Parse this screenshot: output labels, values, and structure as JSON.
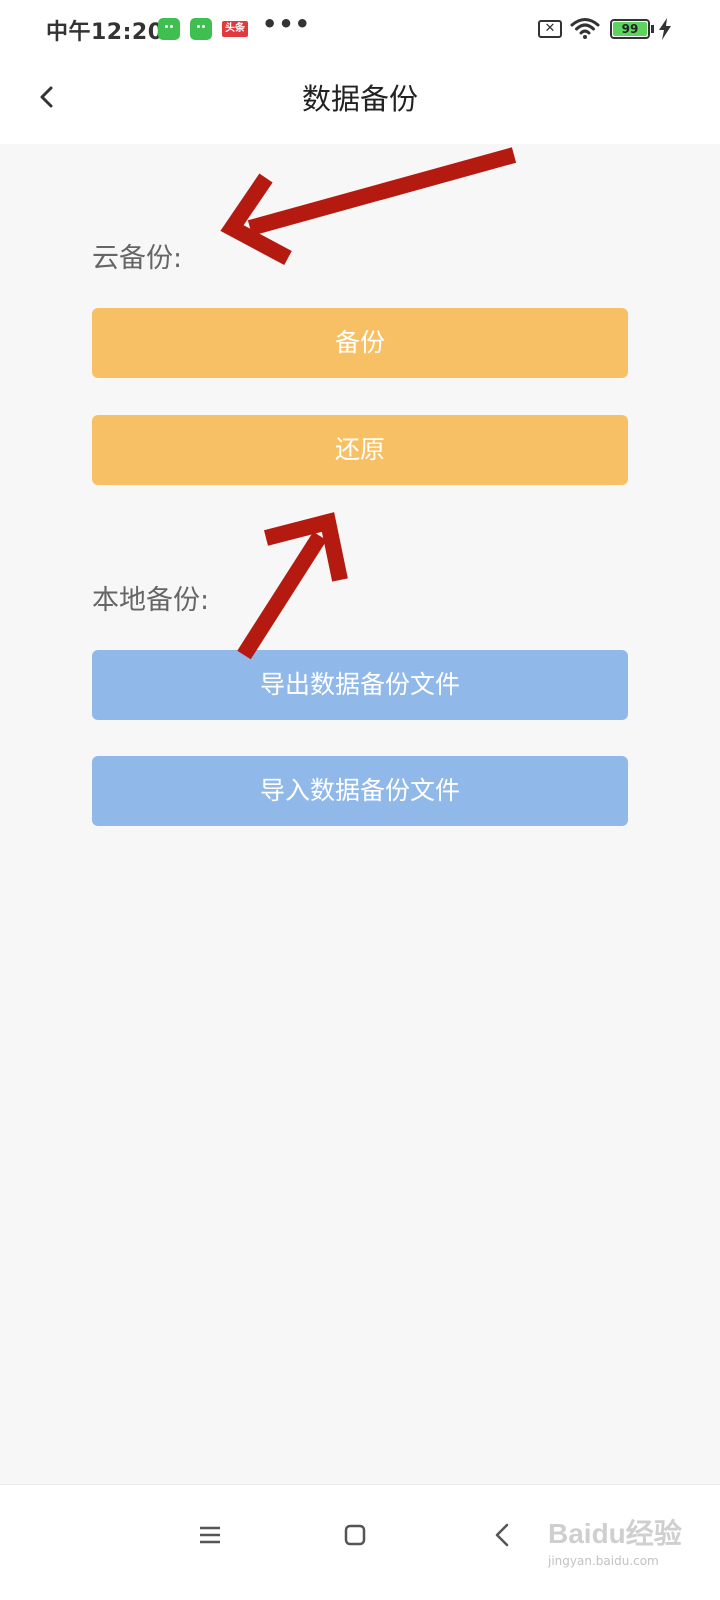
{
  "status_bar": {
    "time": "中午12:20",
    "notification_icons": [
      "app-icon",
      "app-icon",
      "toutiao-icon"
    ],
    "toutiao_label": "头条",
    "more": "•••",
    "battery_level": "99"
  },
  "header": {
    "title": "数据备份"
  },
  "cloud_backup": {
    "label": "云备份:",
    "backup_button": "备份",
    "restore_button": "还原"
  },
  "local_backup": {
    "label": "本地备份:",
    "export_button": "导出数据备份文件",
    "import_button": "导入数据备份文件"
  },
  "colors": {
    "cloud_button": "#f8c064",
    "local_button": "#90b9ea",
    "annotation_arrow": "#b51a10"
  },
  "watermark": {
    "brand": "Baidu经验",
    "url": "jingyan.baidu.com"
  }
}
